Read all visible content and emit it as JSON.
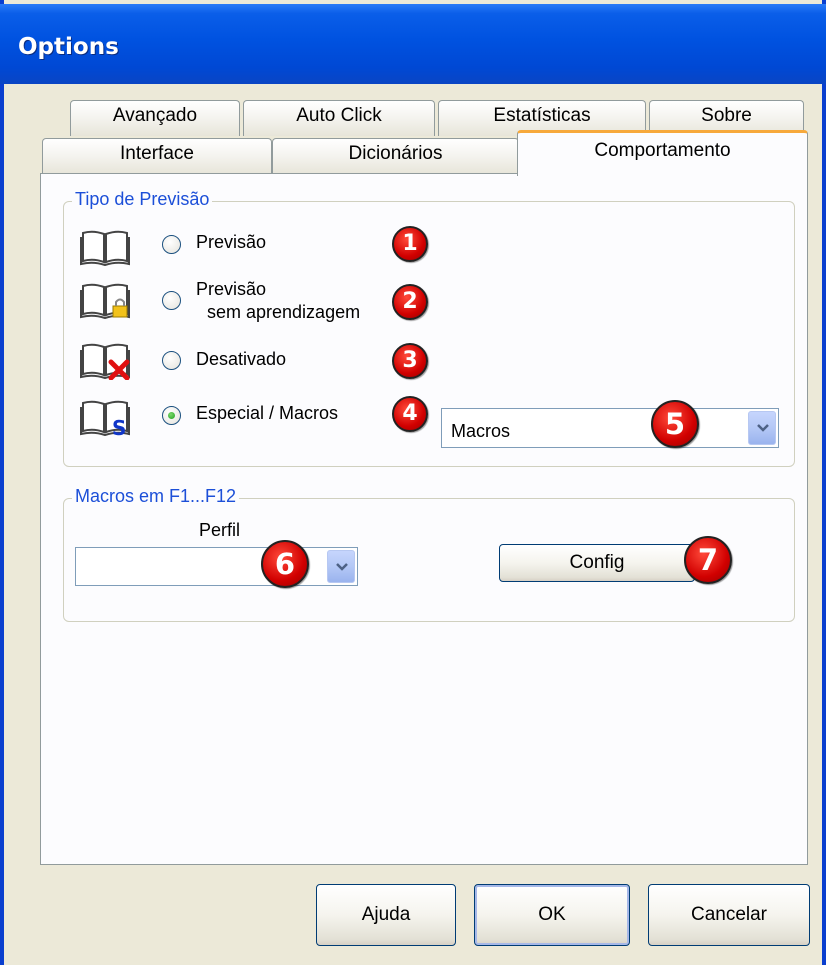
{
  "window": {
    "title": "Options"
  },
  "tabs": {
    "row_back": [
      "Avançado",
      "Auto Click",
      "Estatísticas",
      "Sobre"
    ],
    "row_front": [
      "Interface",
      "Dicionários",
      "Comportamento"
    ],
    "active": "Comportamento"
  },
  "prediction_group": {
    "label": "Tipo de Previsão",
    "options": [
      {
        "label": "Previsão",
        "icon": "book-icon",
        "badge": "1",
        "checked": false
      },
      {
        "label": "Previsão",
        "label2": "sem aprendizagem",
        "icon": "book-lock-icon",
        "badge": "2",
        "checked": false
      },
      {
        "label": "Desativado",
        "icon": "book-disabled-icon",
        "badge": "3",
        "checked": false
      },
      {
        "label": "Especial / Macros",
        "icon": "book-special-icon",
        "badge": "4",
        "checked": true
      }
    ],
    "mode_select": {
      "value": "Macros",
      "badge": "5"
    }
  },
  "macros_group": {
    "label": "Macros em F1...F12",
    "profile_label": "Perfil",
    "profile_select": {
      "value": "",
      "badge": "6"
    },
    "config_button": {
      "label": "Config",
      "badge": "7"
    }
  },
  "footer": {
    "help": "Ajuda",
    "ok": "OK",
    "cancel": "Cancelar"
  },
  "colors": {
    "titlebar": "#0052e0",
    "dialog": "#ece9d8",
    "panel": "#fcfcfe",
    "group_label": "#1c4fd8",
    "badge": "#d10000",
    "tab_highlight": "#f7a93b"
  }
}
